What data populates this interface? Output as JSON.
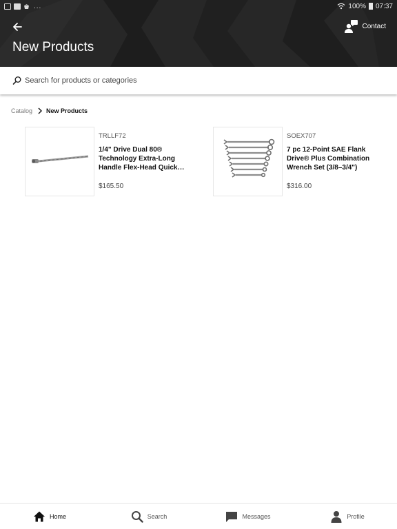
{
  "status_bar": {
    "battery": "100%",
    "time": "07:37",
    "overflow": "..."
  },
  "header": {
    "title": "New Products",
    "contact_label": "Contact"
  },
  "search": {
    "placeholder": "Search for products or categories"
  },
  "breadcrumb": {
    "root": "Catalog",
    "current": "New Products"
  },
  "products": [
    {
      "sku": "TRLLF72",
      "title": "1/4\" Drive Dual 80® Technology Extra-Long Handle Flex-Head Quick…",
      "price": "$165.50"
    },
    {
      "sku": "SOEX707",
      "title": "7 pc 12-Point SAE Flank Drive® Plus Combination Wrench Set (3/8–3/4\")",
      "price": "$316.00"
    }
  ],
  "nav": {
    "items": [
      {
        "label": "Home",
        "icon": "home-icon"
      },
      {
        "label": "Search",
        "icon": "search-icon"
      },
      {
        "label": "Messages",
        "icon": "messages-icon"
      },
      {
        "label": "Profile",
        "icon": "profile-icon"
      }
    ]
  },
  "colors": {
    "header_bg": "#262626",
    "accent": "#111111"
  }
}
